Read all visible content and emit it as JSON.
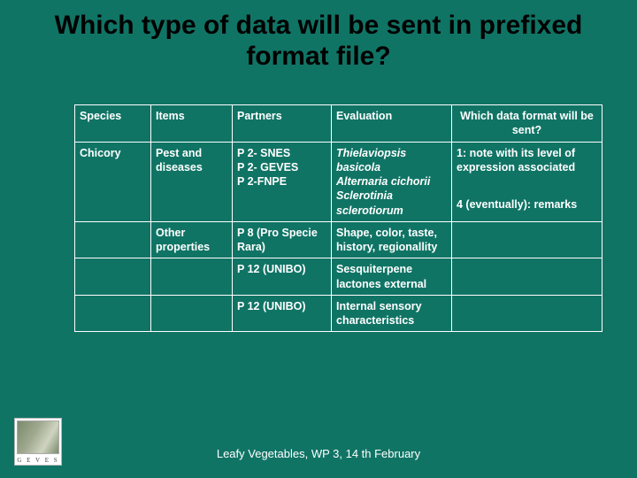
{
  "title": "Which type of data will be sent in prefixed format file?",
  "headers": {
    "species": "Species",
    "items": "Items",
    "partners": "Partners",
    "evaluation": "Evaluation",
    "format": "Which data format will be sent?"
  },
  "rows": [
    {
      "species": "Chicory",
      "items": "Pest and diseases",
      "partners": "P 2- SNES\nP 2- GEVES\nP 2-FNPE",
      "evaluation": "Thielaviopsis basicola\nAlternaria cichorii\nSclerotinia sclerotiorum",
      "format": "1: note with its level of expression associated\n\n4 (eventually): remarks",
      "evalItalic": true
    },
    {
      "species": "",
      "items": "Other properties",
      "partners": "P 8 (Pro Specie Rara)",
      "evaluation": "Shape, color, taste, history, regionallity",
      "format": ""
    },
    {
      "species": "",
      "items": "",
      "partners": "P 12 (UNIBO)",
      "evaluation": "Sesquiterpene lactones external",
      "format": ""
    },
    {
      "species": "",
      "items": "",
      "partners": "P 12 (UNIBO)",
      "evaluation": "Internal sensory characteristics",
      "format": ""
    }
  ],
  "footer": "Leafy Vegetables, WP 3, 14 th February",
  "logoText": "G E V E S"
}
